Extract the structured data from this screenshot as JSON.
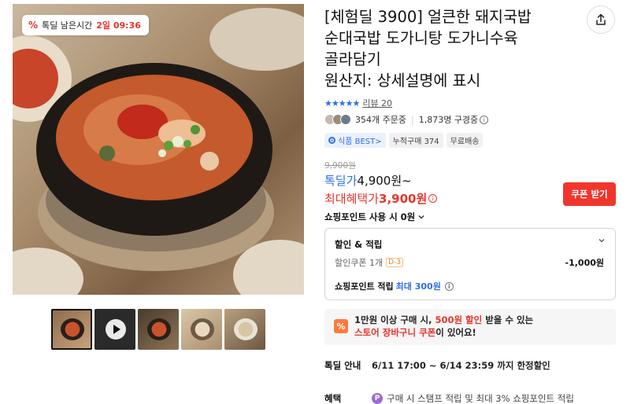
{
  "badge": {
    "label": "톡딜 남은시간",
    "time": "2일 09:36"
  },
  "product": {
    "title_lines": [
      "[체험딜 3900] 얼큰한 돼지국밥",
      "순대국밥 도가니탕 도가니수육",
      "골라담기",
      "원산지: 상세설명에 표시"
    ]
  },
  "rating": {
    "stars": "★★★★★",
    "review_text": "리뷰 20"
  },
  "stats": {
    "orders": "354개 주문중",
    "subscribers": "1,873명 구경중"
  },
  "tags": [
    "식품 BEST>",
    "누적구매 374",
    "무료배송"
  ],
  "price": {
    "original": "9,900원",
    "deal_label": "톡딜가",
    "deal_value": "4,900원~",
    "benefit_label": "최대혜택가",
    "benefit_value": "3,900원"
  },
  "coupon_button": "쿠폰 받기",
  "points_use": "쇼핑포인트 사용 시 0원",
  "discount": {
    "title": "할인 & 적립",
    "coupon_label": "할인쿠폰 1개",
    "coupon_badge": "D-3",
    "coupon_amount": "-1,000원",
    "points_label": "쇼핑포인트 적립",
    "points_value": "최대 300원"
  },
  "cart_banner": {
    "line1_a": "1만원 이상 구매 시, ",
    "line1_b": "500원 할인",
    "line1_c": " 받을 수 있는",
    "line2_a": "스토어 장바구니 쿠폰",
    "line2_b": "이 있어요!"
  },
  "talkdeal_info": {
    "key": "톡딜 안내",
    "value": "6/11 17:00 ~ 6/14 23:59 까지 한정할인"
  },
  "benefit_info": {
    "key": "혜택",
    "value": "구매 시 스탬프 적립 및 최대 3% 쇼핑포인트 적립"
  },
  "colors": {
    "accent_blue": "#2f6fe4",
    "accent_red": "#e8352b",
    "coupon_button": "#f0362c"
  }
}
